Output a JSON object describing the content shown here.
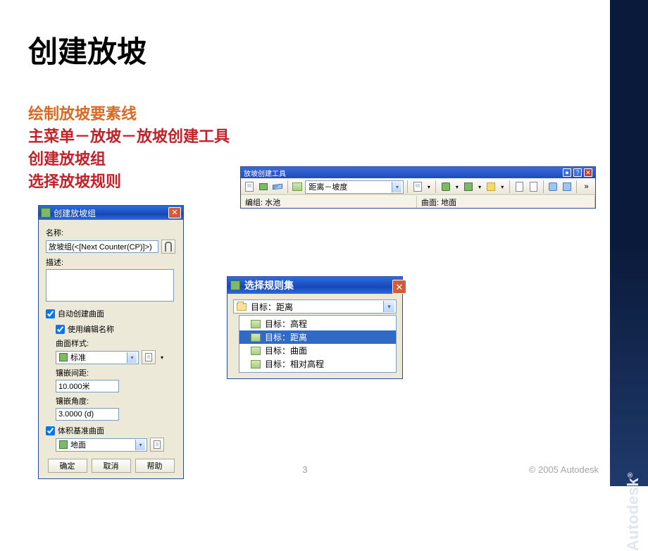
{
  "slide": {
    "title": "创建放坡",
    "page_number": "3",
    "copyright": "© 2005 Autodesk",
    "brand": "Autodesk"
  },
  "bullets": {
    "b1": "绘制放坡要素线",
    "b2": "主菜单－放坡－放坡创建工具",
    "b3": "创建放坡组",
    "b4": "选择放坡规则"
  },
  "toolbar": {
    "title": "放坡创建工具",
    "dropdown_value": "距离－坡度",
    "status_group_label": "编组:",
    "status_group_value": "水池",
    "status_surface_label": "曲面:",
    "status_surface_value": "地面"
  },
  "dialog": {
    "title": "创建放坡组",
    "name_label": "名称:",
    "name_value": "放坡组(<[Next Counter(CP)]>)",
    "desc_label": "描述:",
    "chk_auto": "自动创建曲面",
    "chk_use_edit_name": "使用编辑名称",
    "surface_style_label": "曲面样式:",
    "surface_style_value": "标准",
    "tess_label": "镶嵌间距:",
    "tess_value": "10.000米",
    "angle_label": "镶嵌角度:",
    "angle_value": "3.0000 (d)",
    "chk_vol_base": "体积基准曲面",
    "vol_base_value": "地面",
    "btn_ok": "确定",
    "btn_cancel": "取消",
    "btn_help": "帮助"
  },
  "rules": {
    "title": "选择规则集",
    "combo_value": "目标：距离",
    "items": {
      "0": "目标：高程",
      "1": "目标：距离",
      "2": "目标：曲面",
      "3": "目标：相对高程"
    }
  }
}
